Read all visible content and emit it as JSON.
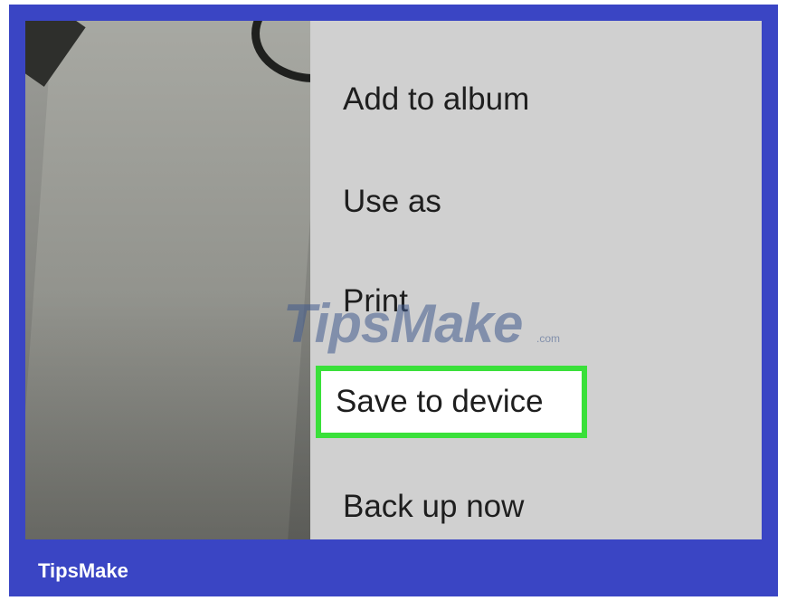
{
  "menu": {
    "items": [
      {
        "label": "Add to album"
      },
      {
        "label": "Use as"
      },
      {
        "label": "Print"
      },
      {
        "label": "Save to device",
        "highlighted": true
      },
      {
        "label": "Back up now"
      }
    ],
    "highlight_color": "#3ae03a"
  },
  "watermark": {
    "text": "TipsMake",
    "domain": ".com"
  },
  "footer": {
    "brand": "TipsMake"
  },
  "colors": {
    "frame": "#3a45c4",
    "menu_background": "#d0d0d0"
  }
}
